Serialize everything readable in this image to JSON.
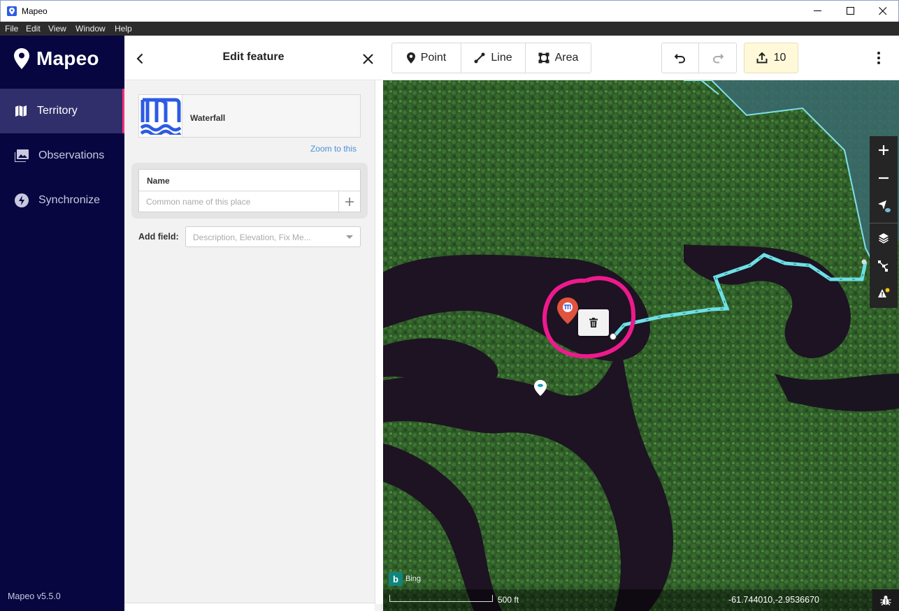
{
  "window": {
    "title": "Mapeo",
    "menu": [
      "File",
      "Edit",
      "View",
      "Window",
      "Help"
    ]
  },
  "sidebar": {
    "logo_text": "Mapeo",
    "items": [
      {
        "label": "Territory",
        "icon": "map-icon",
        "active": true
      },
      {
        "label": "Observations",
        "icon": "photo-icon",
        "active": false
      },
      {
        "label": "Synchronize",
        "icon": "lightning-icon",
        "active": false
      }
    ],
    "version": "Mapeo v5.5.0"
  },
  "panel": {
    "title": "Edit feature",
    "preset_name": "Waterfall",
    "zoom_link": "Zoom to this",
    "name_label": "Name",
    "name_placeholder": "Common name of this place",
    "name_value": "",
    "add_field_label": "Add field:",
    "add_field_placeholder": "Description, Elevation, Fix Me..."
  },
  "toolbar": {
    "point_label": "Point",
    "line_label": "Line",
    "area_label": "Area",
    "upload_count": "10"
  },
  "map": {
    "attribution": "Bing",
    "scale_label": "500 ft",
    "coordinates": "-61.744010,-2.9536670"
  },
  "colors": {
    "sidebar_bg": "#070640",
    "active_accent": "#ff2d7a",
    "brand_blue": "#2d5be3",
    "path_cyan": "#6ee0e6",
    "highlight_magenta": "#ee1a8c",
    "pin_red": "#e0533f"
  }
}
